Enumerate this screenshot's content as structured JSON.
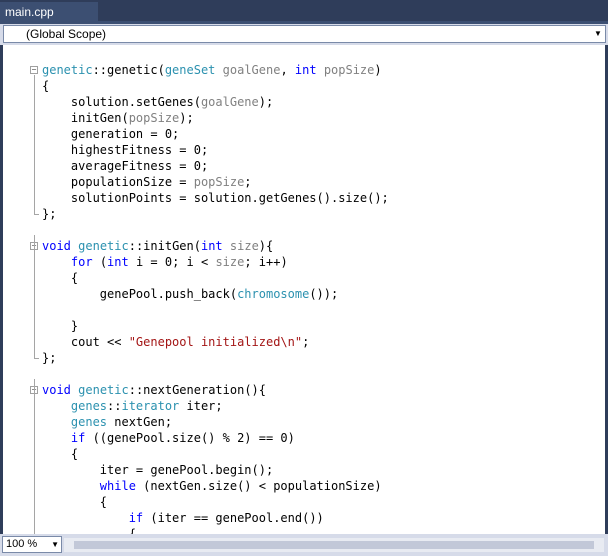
{
  "tab": {
    "title": "main.cpp"
  },
  "navbar": {
    "scope": "(Global Scope)"
  },
  "status": {
    "zoom": "100 %"
  },
  "code_lines": [
    {
      "tokens": [
        [
          "ty",
          "genetic"
        ],
        [
          "",
          "::genetic("
        ],
        [
          "ty",
          "geneSet"
        ],
        [
          "",
          " "
        ],
        [
          "pm",
          "goalGene"
        ],
        [
          "",
          ", "
        ],
        [
          "kw",
          "int"
        ],
        [
          "",
          " "
        ],
        [
          "pm",
          "popSize"
        ],
        [
          "",
          ")"
        ]
      ]
    },
    {
      "tokens": [
        [
          "",
          "{"
        ]
      ]
    },
    {
      "tokens": [
        [
          "",
          "    solution.setGenes("
        ],
        [
          "pm",
          "goalGene"
        ],
        [
          "",
          ");"
        ]
      ]
    },
    {
      "tokens": [
        [
          "",
          "    initGen("
        ],
        [
          "pm",
          "popSize"
        ],
        [
          "",
          ");"
        ]
      ]
    },
    {
      "tokens": [
        [
          "",
          "    generation = 0;"
        ]
      ]
    },
    {
      "tokens": [
        [
          "",
          "    highestFitness = 0;"
        ]
      ]
    },
    {
      "tokens": [
        [
          "",
          "    averageFitness = 0;"
        ]
      ]
    },
    {
      "tokens": [
        [
          "",
          "    populationSize = "
        ],
        [
          "pm",
          "popSize"
        ],
        [
          "",
          ";"
        ]
      ]
    },
    {
      "tokens": [
        [
          "",
          "    solutionPoints = solution.getGenes().size();"
        ]
      ]
    },
    {
      "tokens": [
        [
          "",
          "};"
        ]
      ]
    },
    {
      "tokens": []
    },
    {
      "tokens": [
        [
          "kw",
          "void"
        ],
        [
          "",
          " "
        ],
        [
          "ty",
          "genetic"
        ],
        [
          "",
          "::initGen("
        ],
        [
          "kw",
          "int"
        ],
        [
          "",
          " "
        ],
        [
          "pm",
          "size"
        ],
        [
          "",
          "){"
        ]
      ]
    },
    {
      "tokens": [
        [
          "",
          "    "
        ],
        [
          "kw",
          "for"
        ],
        [
          "",
          " ("
        ],
        [
          "kw",
          "int"
        ],
        [
          "",
          " i = 0; i < "
        ],
        [
          "pm",
          "size"
        ],
        [
          "",
          "; i++)"
        ]
      ]
    },
    {
      "tokens": [
        [
          "",
          "    {"
        ]
      ]
    },
    {
      "tokens": [
        [
          "",
          "        genePool.push_back("
        ],
        [
          "ty",
          "chromosome"
        ],
        [
          "",
          "());"
        ]
      ]
    },
    {
      "tokens": []
    },
    {
      "tokens": [
        [
          "",
          "    }"
        ]
      ]
    },
    {
      "tokens": [
        [
          "",
          "    cout << "
        ],
        [
          "st",
          "\"Genepool initialized\\n\""
        ],
        [
          "",
          ";"
        ]
      ]
    },
    {
      "tokens": [
        [
          "",
          "};"
        ]
      ]
    },
    {
      "tokens": []
    },
    {
      "tokens": [
        [
          "kw",
          "void"
        ],
        [
          "",
          " "
        ],
        [
          "ty",
          "genetic"
        ],
        [
          "",
          "::nextGeneration(){"
        ]
      ]
    },
    {
      "tokens": [
        [
          "",
          "    "
        ],
        [
          "ty",
          "genes"
        ],
        [
          "",
          "::"
        ],
        [
          "ty",
          "iterator"
        ],
        [
          "",
          " iter;"
        ]
      ]
    },
    {
      "tokens": [
        [
          "",
          "    "
        ],
        [
          "ty",
          "genes"
        ],
        [
          "",
          " nextGen;"
        ]
      ]
    },
    {
      "tokens": [
        [
          "",
          "    "
        ],
        [
          "kw",
          "if"
        ],
        [
          "",
          " ((genePool.size() % 2) == 0)"
        ]
      ]
    },
    {
      "tokens": [
        [
          "",
          "    {"
        ]
      ]
    },
    {
      "tokens": [
        [
          "",
          "        iter = genePool.begin();"
        ]
      ]
    },
    {
      "tokens": [
        [
          "",
          "        "
        ],
        [
          "kw",
          "while"
        ],
        [
          "",
          " (nextGen.size() < populationSize)"
        ]
      ]
    },
    {
      "tokens": [
        [
          "",
          "        {"
        ]
      ]
    },
    {
      "tokens": [
        [
          "",
          "            "
        ],
        [
          "kw",
          "if"
        ],
        [
          "",
          " (iter == genePool.end())"
        ]
      ]
    },
    {
      "tokens": [
        [
          "",
          "            {"
        ]
      ]
    }
  ]
}
